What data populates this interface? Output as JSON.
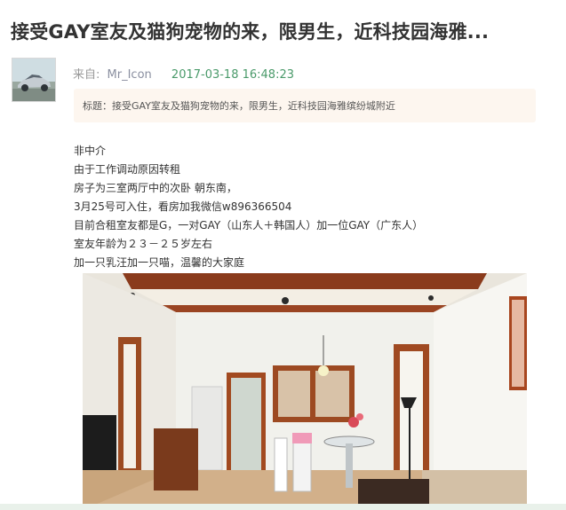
{
  "post": {
    "title": "接受GAY室友及猫狗宠物的来，限男生，近科技园海雅...",
    "from_label": "来自:",
    "author": "Mr_Icon",
    "timestamp": "2017-03-18 16:48:23",
    "subject_line": "标题：接受GAY室友及猫狗宠物的来，限男生，近科技园海雅缤纷城附近",
    "body": [
      "非中介",
      "由于工作调动原因转租",
      "房子为三室两厅中的次卧 朝东南，",
      "3月25号可入住，看房加我微信w896366504",
      "目前合租室友都是G，一对GAY（山东人＋韩国人）加一位GAY（广东人）",
      "室友年龄为２３－２５岁左右",
      "加一只乳汪加一只喵，温馨的大家庭"
    ]
  },
  "colors": {
    "title": "#333333",
    "timestamp": "#4a9a6a",
    "subject_bg": "#fdf6ef",
    "body_text": "#333333"
  }
}
